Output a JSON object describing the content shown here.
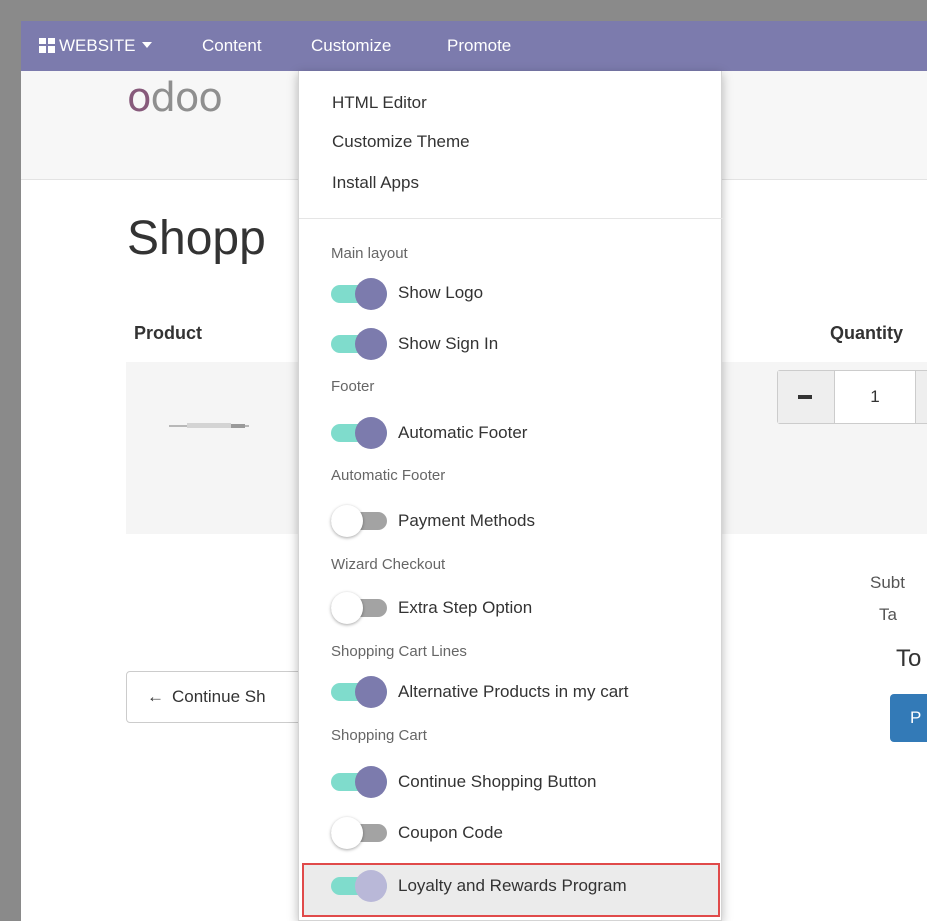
{
  "topbar": {
    "website_label": "WEBSITE",
    "menu": [
      "Content",
      "Customize",
      "Promote"
    ]
  },
  "site": {
    "logo_first": "o",
    "logo_rest": "doo",
    "page_title": "Shopp",
    "cart": {
      "col_product": "Product",
      "col_quantity": "Quantity",
      "qty_minus": "−",
      "qty_value": "1",
      "subtotal_label": "Subt",
      "taxes_label": "Ta",
      "total_label": "To",
      "process_label": "P",
      "continue_label": "Continue Sh",
      "continue_arrow": "←"
    }
  },
  "dropdown": {
    "links": [
      "HTML Editor",
      "Customize Theme",
      "Install Apps"
    ],
    "sections": {
      "main_layout": "Main layout",
      "footer": "Footer",
      "automatic_footer": "Automatic Footer",
      "wizard_checkout": "Wizard Checkout",
      "cart_lines": "Shopping Cart Lines",
      "shopping_cart": "Shopping Cart"
    },
    "options": {
      "show_logo": {
        "label": "Show Logo",
        "enabled": true
      },
      "show_sign_in": {
        "label": "Show Sign In",
        "enabled": true
      },
      "automatic_footer": {
        "label": "Automatic Footer",
        "enabled": true
      },
      "payment_methods": {
        "label": "Payment Methods",
        "enabled": false
      },
      "extra_step": {
        "label": "Extra Step Option",
        "enabled": false
      },
      "alternative_products": {
        "label": "Alternative Products in my cart",
        "enabled": true
      },
      "continue_shopping": {
        "label": "Continue Shopping Button",
        "enabled": true
      },
      "coupon_code": {
        "label": "Coupon Code",
        "enabled": false
      },
      "loyalty_rewards": {
        "label": "Loyalty and Rewards Program",
        "enabled": true
      }
    }
  },
  "colors": {
    "topbar_bg": "#7c7bad",
    "toggle_track_on": "#7fdccc",
    "toggle_knob_on": "#7c7bad",
    "highlight_border": "#e04a4a",
    "logo_accent": "#875a7b"
  }
}
